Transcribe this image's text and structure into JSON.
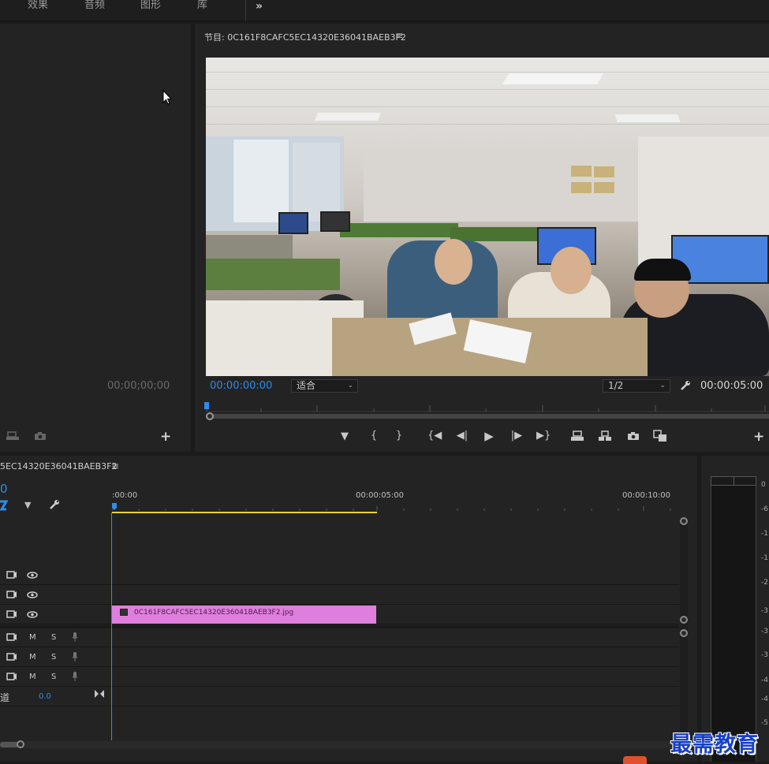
{
  "workspace_tabs": [
    "效果",
    "音频",
    "图形",
    "库"
  ],
  "more_label": "»",
  "source": {
    "timecode": "00;00;00;00",
    "add_label": "+"
  },
  "program": {
    "title": "节目: 0C161F8CAFC5EC14320E36041BAEB3F2",
    "menu": "≡",
    "timecode_current": "00:00:00:00",
    "fit_option": "适合",
    "resolution": "1/2",
    "timecode_duration": "00:00:05:00",
    "add_label": "+"
  },
  "timeline": {
    "title": "5EC14320E36041BAEB3F2",
    "menu": "≡",
    "playhead_value": "0",
    "ruler": [
      ":00:00",
      "00:00:05:00",
      "00:00:10:00"
    ],
    "audio_master_label": "道",
    "audio_master_value": "0.0",
    "mute_label": "M",
    "solo_label": "S",
    "clip_name": "0C161F8CAFC5EC14320E36041BAEB3F2.jpg",
    "clip_color": "#df7fdd"
  },
  "meter": {
    "scale": [
      "0",
      "-6",
      "-1",
      "-1",
      "-2",
      "-3",
      "-3",
      "-3",
      "-4",
      "-4",
      "-5"
    ]
  },
  "watermark": "最需教育",
  "colors": {
    "accent_blue": "#2d8ceb",
    "work_area_yellow": "#e8d33a"
  }
}
